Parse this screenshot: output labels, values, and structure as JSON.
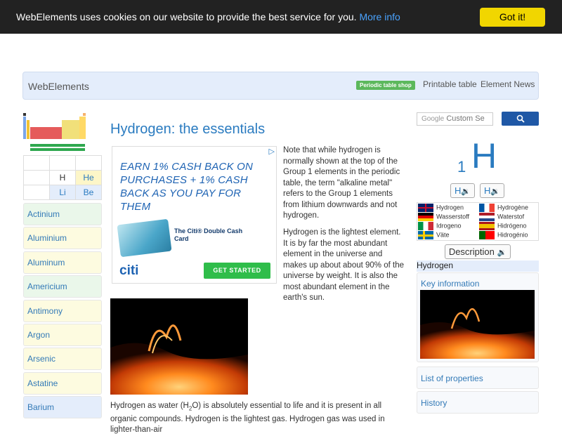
{
  "cookie_bar": {
    "message": "WebElements uses cookies on our website to provide the best service for you.",
    "more_info": "More info",
    "button": "Got it!"
  },
  "header": {
    "brand": "WebElements",
    "shop_badge": "Periodic table shop",
    "printable": "Printable table",
    "news": "Element News"
  },
  "mini_grid": {
    "h": "H",
    "he": "He",
    "li": "Li",
    "be": "Be"
  },
  "element_list": [
    "Actinium",
    "Aluminium",
    "Aluminum",
    "Americium",
    "Antimony",
    "Argon",
    "Arsenic",
    "Astatine",
    "Barium"
  ],
  "element_list_colors": [
    "#eaf7ea",
    "#fdfbe0",
    "#fdfbe0",
    "#eaf7ea",
    "#fdfbe0",
    "#fdfbe0",
    "#fdfbe0",
    "#fdfbe0",
    "#e4edfb"
  ],
  "main": {
    "title": "Hydrogen: the essentials",
    "p1": "Note that while hydrogen is normally shown at the top of the Group 1 elements in the periodic table, the term \"alkaline metal\" refers to the Group 1 elements from lithium downwards and not hydrogen.",
    "p2": "Hydrogen is the lightest element. It is by far the most abundant element in the universe and makes up about about 90% of the universe by weight. It is also the most abundant element in the earth's sun.",
    "p3_a": "Hydrogen as water (H",
    "p3_sub": "2",
    "p3_b": "O) is absolutely essential to life and it is present in all organic compounds. Hydrogen is the lightest gas. Hydrogen gas was used in lighter-than-air"
  },
  "ad": {
    "headline": "Earn 1% cash back on purchases + 1% cash back as you pay for them",
    "card_name": "The Citi® Double Cash Card",
    "logo": "citi",
    "cta": "GET STARTED",
    "adchoices_icon": "adchoices-icon"
  },
  "sidebar": {
    "search_placeholder": "Custom Se",
    "search_brand": "Google",
    "atomic_number": "1",
    "symbol": "H",
    "pron1": "H",
    "pron2": "H",
    "languages": [
      {
        "name": "Hydrogen",
        "flag": "uk"
      },
      {
        "name": "Hydrogène",
        "flag": "fr"
      },
      {
        "name": "Wasserstoff",
        "flag": "de"
      },
      {
        "name": "Waterstof",
        "flag": "nl"
      },
      {
        "name": "Idrogeno",
        "flag": "it"
      },
      {
        "name": "Hidrógeno",
        "flag": "es"
      },
      {
        "name": "Väte",
        "flag": "se"
      },
      {
        "name": "Hidrogénio",
        "flag": "pt"
      }
    ],
    "description_button": "Description",
    "element_name": "Hydrogen",
    "key_information": "Key information",
    "list_of_properties": "List of properties",
    "history": "History"
  }
}
